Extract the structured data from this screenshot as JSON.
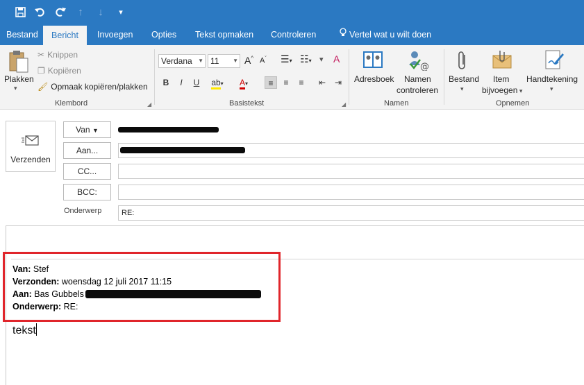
{
  "colors": {
    "accent": "#2b79c2",
    "highlight_border": "#e0252b"
  },
  "quick_access": {
    "icons": [
      "save-icon",
      "undo-icon",
      "redo-icon",
      "up-arrow-icon",
      "down-arrow-icon",
      "customize-icon"
    ]
  },
  "tabs": [
    {
      "label": "Bestand"
    },
    {
      "label": "Bericht"
    },
    {
      "label": "Invoegen"
    },
    {
      "label": "Opties"
    },
    {
      "label": "Tekst opmaken"
    },
    {
      "label": "Controleren"
    },
    {
      "label": "Vertel wat u wilt doen"
    }
  ],
  "ribbon": {
    "clipboard": {
      "paste": "Plakken",
      "cut": "Knippen",
      "copy": "Kopiëren",
      "format_painter": "Opmaak kopiëren/plakken",
      "group": "Klembord"
    },
    "basic_text": {
      "font": "Verdana",
      "size": "11",
      "group": "Basistekst"
    },
    "names": {
      "address_book": "Adresboek",
      "check_names_1": "Namen",
      "check_names_2": "controleren",
      "group": "Namen"
    },
    "include": {
      "attach_file": "Bestand",
      "attach_item_1": "Item",
      "attach_item_2": "bijvoegen",
      "signature": "Handtekening",
      "group": "Opnemen"
    }
  },
  "compose": {
    "send": "Verzenden",
    "from": "Van",
    "to": "Aan...",
    "cc": "CC...",
    "bcc": "BCC:",
    "subject_label": "Onderwerp",
    "subject_value": "RE:"
  },
  "quoted": {
    "from_label": "Van:",
    "from_value": "Stef",
    "sent_label": "Verzonden:",
    "sent_value": "woensdag 12 juli 2017 11:15",
    "to_label": "Aan:",
    "to_value": "Bas Gubbels",
    "subject_label": "Onderwerp:",
    "subject_value": "RE:"
  },
  "body_text": "tekst"
}
